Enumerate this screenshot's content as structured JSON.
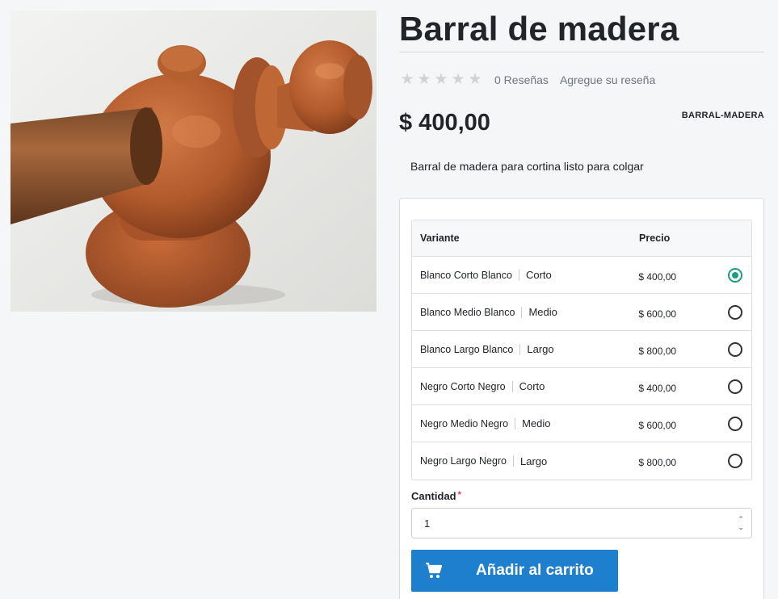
{
  "product": {
    "title": "Barral de madera",
    "rating": {
      "stars_filled": 0,
      "stars_total": 5,
      "reviews_text": "0 Reseñas",
      "add_review_text": "Agregue su reseña"
    },
    "price": "$ 400,00",
    "sku": "BARRAL-MADERA",
    "description": "Barral de madera para cortina listo para colgar",
    "image_alt": "wooden-curtain-rod-photo"
  },
  "variants": {
    "header": {
      "variant": "Variante",
      "price": "Precio"
    },
    "rows": [
      {
        "name": "Blanco Corto Blanco",
        "size": "Corto",
        "price": "$ 400,00",
        "selected": true
      },
      {
        "name": "Blanco Medio Blanco",
        "size": "Medio",
        "price": "$ 600,00",
        "selected": false
      },
      {
        "name": "Blanco Largo Blanco",
        "size": "Largo",
        "price": "$ 800,00",
        "selected": false
      },
      {
        "name": "Negro Corto Negro",
        "size": "Corto",
        "price": "$ 400,00",
        "selected": false
      },
      {
        "name": "Negro Medio Negro",
        "size": "Medio",
        "price": "$ 600,00",
        "selected": false
      },
      {
        "name": "Negro Largo Negro",
        "size": "Largo",
        "price": "$ 800,00",
        "selected": false
      }
    ]
  },
  "quantity": {
    "label": "Cantidad",
    "required_mark": "*",
    "value": "1"
  },
  "cart": {
    "button_label": "Añadir al carrito",
    "icon": "cart-icon"
  },
  "colors": {
    "accent_blue": "#1f7fcf",
    "radio_selected": "#1b9e7e",
    "required": "#dc3545"
  }
}
